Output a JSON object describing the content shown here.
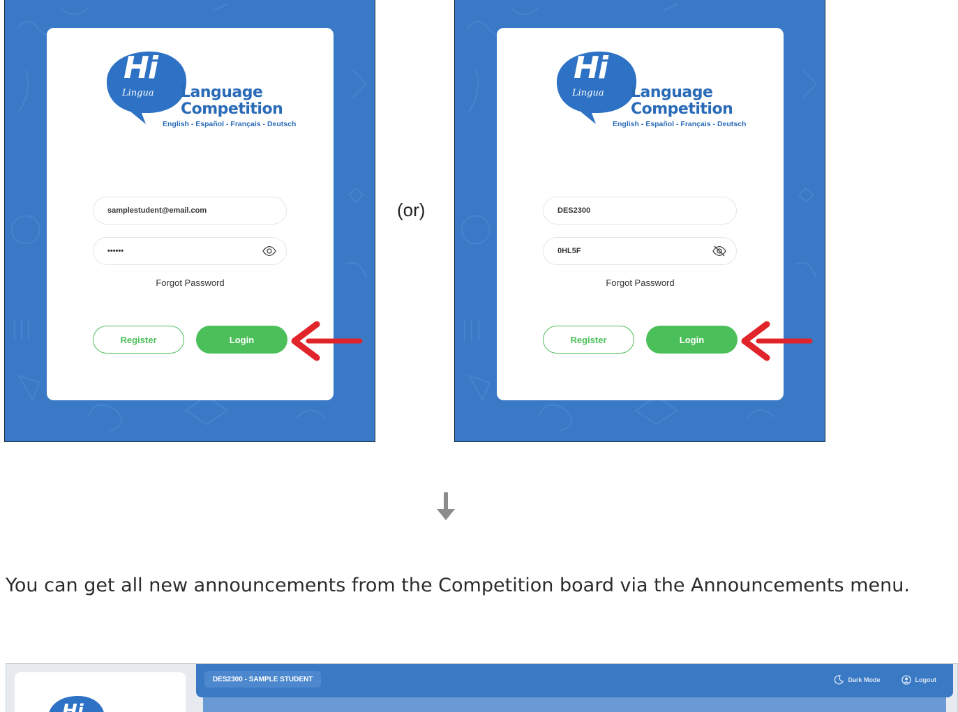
{
  "login_panels": [
    {
      "logo": {
        "hi": "Hi",
        "lingua": "Lingua",
        "line1": "Language",
        "line2": "Competition",
        "languages": "English - Español - Français - Deutsch"
      },
      "username_value": "samplestudent@email.com",
      "password_value": "••••••",
      "password_icon": "eye-icon",
      "forgot_label": "Forgot Password",
      "register_label": "Register",
      "login_label": "Login"
    },
    {
      "logo": {
        "hi": "Hi",
        "lingua": "Lingua",
        "line1": "Language",
        "line2": "Competition",
        "languages": "English - Español - Français - Deutsch"
      },
      "username_value": "DES2300",
      "password_value": "0HL5F",
      "password_icon": "eye-slash-icon",
      "forgot_label": "Forgot Password",
      "register_label": "Register",
      "login_label": "Login"
    }
  ],
  "separator": "(or)",
  "caption": "You can get all new announcements from the Competition board via the Announcements menu.",
  "app": {
    "student_label": "DES2300 - SAMPLE STUDENT",
    "dark_mode_label": "Dark Mode",
    "logout_label": "Logout",
    "logo_hi": "Hi"
  },
  "colors": {
    "panel_blue": "#3979c6",
    "brand_blue": "#2a6bb8",
    "login_green": "#4bbf5a",
    "pointer_red": "#e0242a",
    "topbar_blue": "#3a79c4"
  }
}
